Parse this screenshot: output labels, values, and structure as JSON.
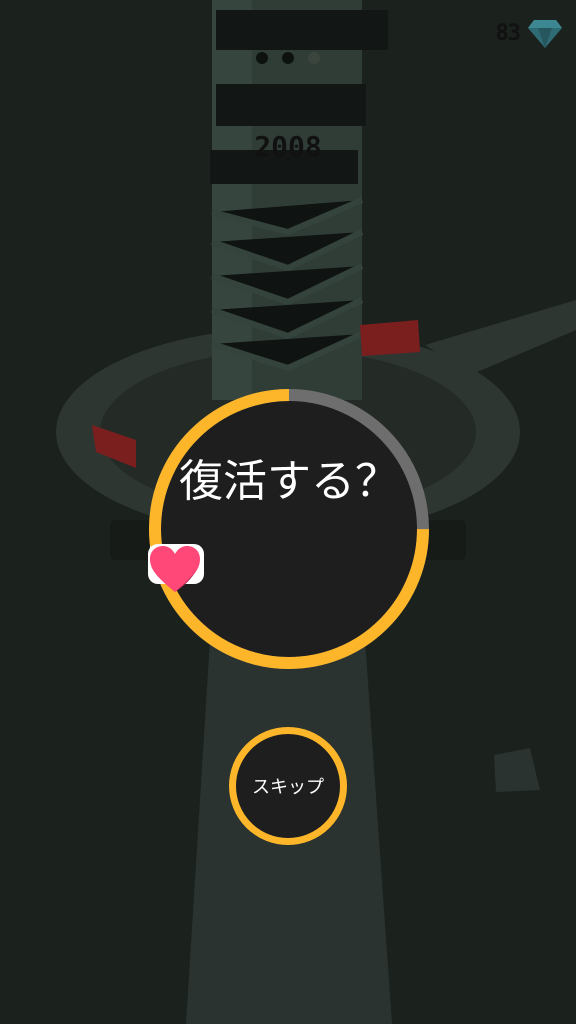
{
  "hud": {
    "gem_count": "83",
    "gem_icon": "diamond-icon"
  },
  "level": {
    "score": "2008",
    "stage_progress": {
      "completed": 2,
      "total": 3
    }
  },
  "revive_dialog": {
    "title": "復活する？",
    "timer_remaining_fraction": 0.75,
    "icons": [
      "video-play-icon",
      "arrow-right-icon",
      "heart-icon"
    ],
    "skip_label": "スキップ"
  },
  "colors": {
    "accent": "#fdb629",
    "timer_track": "#6e6e6e",
    "dialog_bg": "#1e1e1e",
    "heart": "#ff4778",
    "obstacle": "#7a1e1e"
  }
}
